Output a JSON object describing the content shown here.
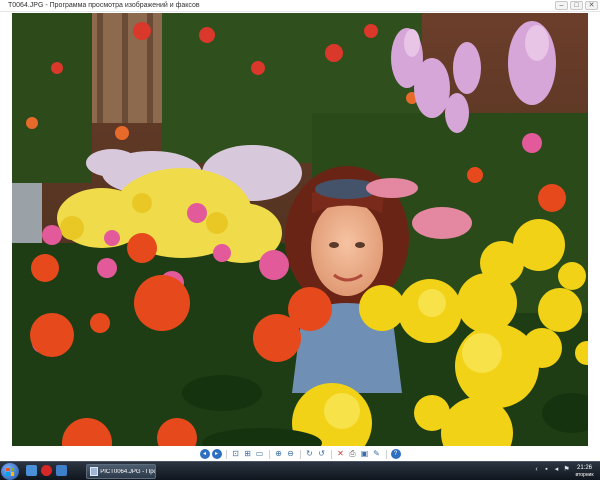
{
  "window": {
    "title": "T0064.JPG - Программа просмотра изображений и факсов",
    "controls": {
      "minimize": "–",
      "maximize": "□",
      "close": "✕"
    }
  },
  "photo": {
    "icon": "photo-content",
    "colors": {
      "sky": "#7a4a34",
      "foliage": "#2e5a1e",
      "yellow": "#f2d21c",
      "orange": "#e8501a",
      "pink": "#e06aa0",
      "lilac": "#d9a7d6",
      "hair": "#6a2a1c",
      "skin": "#f0b090"
    }
  },
  "toolbar": {
    "buttons": [
      {
        "name": "prev-image-button",
        "icon": "arrow-left-icon",
        "glyph": "◂"
      },
      {
        "name": "next-image-button",
        "icon": "arrow-right-icon",
        "glyph": "▸"
      },
      {
        "name": "best-fit-button",
        "icon": "best-fit-icon",
        "glyph": "⊡"
      },
      {
        "name": "actual-size-button",
        "icon": "actual-size-icon",
        "glyph": "⊞"
      },
      {
        "name": "slideshow-button",
        "icon": "slideshow-icon",
        "glyph": "▭"
      },
      {
        "name": "zoom-in-button",
        "icon": "zoom-in-icon",
        "glyph": "⊕"
      },
      {
        "name": "zoom-out-button",
        "icon": "zoom-out-icon",
        "glyph": "⊖"
      },
      {
        "name": "rotate-cw-button",
        "icon": "rotate-cw-icon",
        "glyph": "↻"
      },
      {
        "name": "rotate-ccw-button",
        "icon": "rotate-ccw-icon",
        "glyph": "↺"
      },
      {
        "name": "delete-button",
        "icon": "delete-icon",
        "glyph": "✕"
      },
      {
        "name": "print-button",
        "icon": "print-icon",
        "glyph": "⎙"
      },
      {
        "name": "save-button",
        "icon": "save-icon",
        "glyph": "▣"
      },
      {
        "name": "edit-button",
        "icon": "edit-icon",
        "glyph": "✎"
      },
      {
        "name": "help-button",
        "icon": "help-icon",
        "glyph": "?"
      }
    ]
  },
  "taskbar": {
    "start_icon": "windows-flag-icon",
    "quick_launch": [
      {
        "name": "ie-icon",
        "color": "#4a90d9"
      },
      {
        "name": "opera-icon",
        "color": "#d62828"
      },
      {
        "name": "show-desktop-icon",
        "color": "#3f7fc9"
      }
    ],
    "task": {
      "label": "PICT0064.JPG - Про...",
      "icon": "image-viewer-icon"
    },
    "tray": [
      {
        "name": "tray-arrow-icon",
        "glyph": "‹"
      },
      {
        "name": "network-icon",
        "glyph": "▪"
      },
      {
        "name": "volume-icon",
        "glyph": "◂"
      },
      {
        "name": "flag-icon",
        "glyph": "⚑"
      }
    ],
    "clock": {
      "time": "21:26",
      "day": "вторник"
    }
  }
}
